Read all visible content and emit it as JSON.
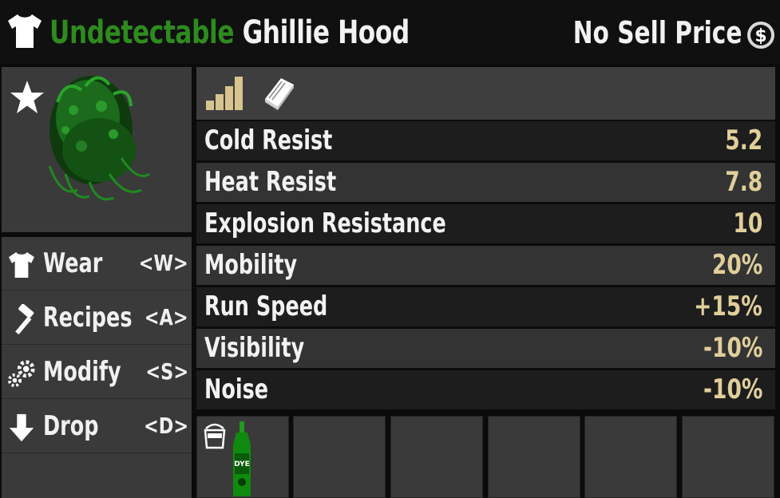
{
  "header": {
    "quality_label": "Undetectable",
    "item_name": "Ghillie Hood",
    "price_text": "No Sell Price",
    "quality_color": "#2e8b1e",
    "icons": [
      "shirt-icon",
      "coin-icon"
    ]
  },
  "preview": {
    "icons": [
      "favorite-star-icon",
      "ghillie-hood-image"
    ]
  },
  "actions": [
    {
      "label": "Wear",
      "key": "<W>",
      "icon": "shirt-icon"
    },
    {
      "label": "Recipes",
      "key": "<A>",
      "icon": "hammer-icon"
    },
    {
      "label": "Modify",
      "key": "<S>",
      "icon": "gears-icon"
    },
    {
      "label": "Drop",
      "key": "<D>",
      "icon": "arrow-down-icon"
    }
  ],
  "stats_tabs": {
    "icons": [
      "stats-bars-icon",
      "book-icon"
    ]
  },
  "stats": [
    {
      "name": "Cold Resist",
      "value": "5.2"
    },
    {
      "name": "Heat Resist",
      "value": "7.8"
    },
    {
      "name": "Explosion Resistance",
      "value": "10"
    },
    {
      "name": "Mobility",
      "value": "20%"
    },
    {
      "name": "Run Speed",
      "value": "+15%"
    },
    {
      "name": "Visibility",
      "value": "-10%"
    },
    {
      "name": "Noise",
      "value": "-10%"
    }
  ],
  "mod_slots": {
    "count": 6,
    "filled": [
      {
        "slot": 1,
        "item": "green-dye",
        "icon": "paint-bucket-icon",
        "label": "DYE"
      }
    ]
  },
  "colors": {
    "stat_value": "#e0cf9a",
    "text": "#f2f2f2"
  }
}
